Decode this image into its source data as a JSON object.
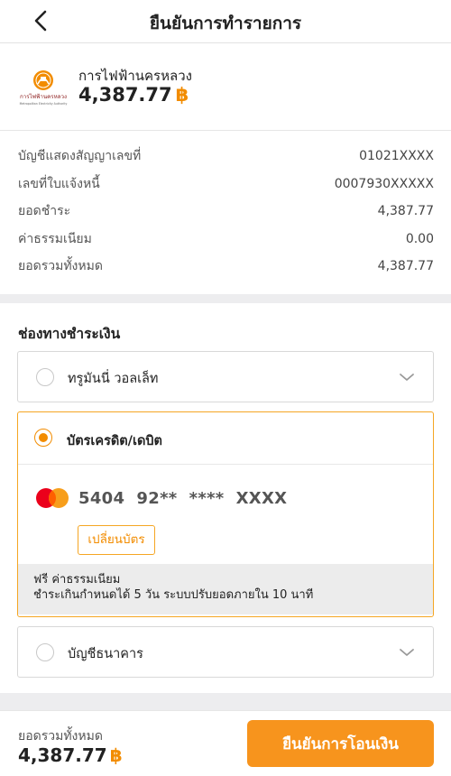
{
  "header": {
    "title": "ยืนยันการทำรายการ"
  },
  "merchant": {
    "logo_text": "การไฟฟ้านครหลวง",
    "logo_subtext": "Metropolitan Electricity Authority",
    "name": "การไฟฟ้านครหลวง",
    "amount": "4,387.77",
    "currency": "฿"
  },
  "details": [
    {
      "label": "บัญชีแสดงสัญญาเลขที่",
      "value": "01021XXXX"
    },
    {
      "label": "เลขที่ใบแจ้งหนี้",
      "value": "0007930XXXXX"
    },
    {
      "label": "ยอดชำระ",
      "value": "4,387.77"
    },
    {
      "label": "ค่าธรรมเนียม",
      "value": "0.00"
    },
    {
      "label": "ยอดรวมทั้งหมด",
      "value": "4,387.77"
    }
  ],
  "payment": {
    "title": "ช่องทางชำระเงิน",
    "options": [
      {
        "label": "ทรูมันนี่ วอลเล็ท",
        "selected": false,
        "icon": "chevron-down-icon"
      },
      {
        "label": "บัตรเครดิต/เดบิต",
        "selected": true,
        "card_number": "5404  92**  ****  XXXX",
        "card_brand": "mastercard",
        "change_label": "เปลี่ยนบัตร",
        "fee_line1": "ฟรี ค่าธรรมเนียม",
        "fee_line2": "ชำระเกินกำหนดได้ 5 วัน ระบบปรับยอดภายใน 10 นาที"
      },
      {
        "label": "บัญชีธนาคาร",
        "selected": false,
        "icon": "chevron-down-icon"
      }
    ]
  },
  "footer": {
    "total_label": "ยอดรวมทั้งหมด",
    "total_amount": "4,387.77",
    "currency": "฿",
    "confirm_label": "ยืนยันการโอนเงิน"
  },
  "colors": {
    "accent": "#f7941d",
    "accent_border": "#f5a623",
    "band": "#ededef"
  },
  "icons": [
    "back-arrow-icon",
    "mea-logo-icon",
    "radio-icon",
    "chevron-down-icon",
    "mastercard-icon"
  ]
}
